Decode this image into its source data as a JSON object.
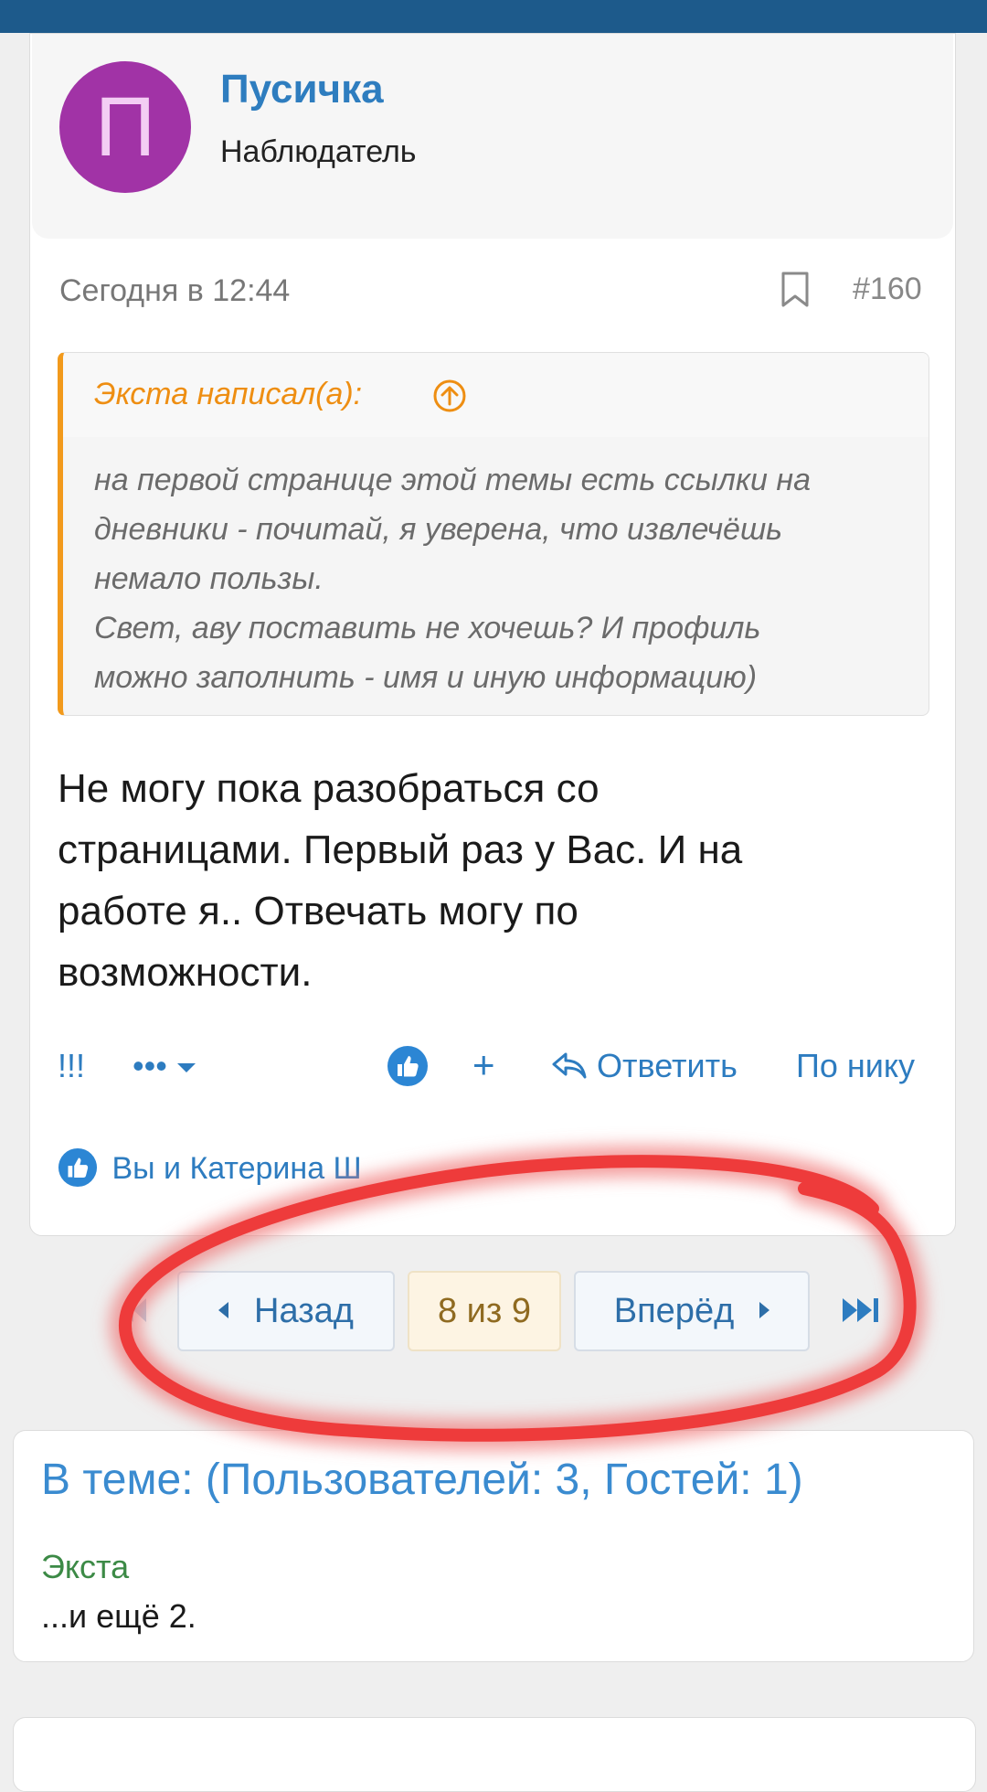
{
  "post": {
    "user": {
      "avatar_letter": "П",
      "name": "Пусичка",
      "title": "Наблюдатель"
    },
    "date": "Сегодня в 12:44",
    "number": "#160",
    "quote": {
      "author": "Экста написал(а):",
      "line1": "на первой странице этой темы есть ссылки на",
      "line2": "дневники - почитай, я уверена, что извлечёшь",
      "line3": "немало пользы.",
      "line4": "Свет, аву поставить не хочешь? И профиль",
      "line5": "можно заполнить - имя и иную информацию)"
    },
    "message": {
      "line1": "Не могу пока разобраться со",
      "line2": "страницами. Первый раз у Вас. И на",
      "line3": "работе я.. Отвечать могу по",
      "line4": "возможности."
    },
    "actions": {
      "exclaim": "!!!",
      "more": "•••",
      "plus": "+",
      "reply": "Ответить",
      "by_nick": "По нику"
    },
    "reactions": "Вы и Катерина Ш"
  },
  "pagination": {
    "prev": "Назад",
    "current": "8 из 9",
    "next": "Вперёд"
  },
  "online": {
    "title": "В теме: (Пользователей: 3, Гостей: 1)",
    "user": "Экста",
    "more": "...и ещё 2."
  },
  "colors": {
    "topbar": "#1d5a8b",
    "link": "#2d7cc0",
    "avatar": "#a133a6",
    "quote_accent": "#f29a1c",
    "annotation": "#ee3b3b",
    "online_user": "#3c8a46"
  },
  "icons": [
    "bookmark-icon",
    "arrow-up-circle-icon",
    "like-icon",
    "caret-down-icon",
    "reply-icon",
    "first-page-icon",
    "last-page-icon"
  ]
}
